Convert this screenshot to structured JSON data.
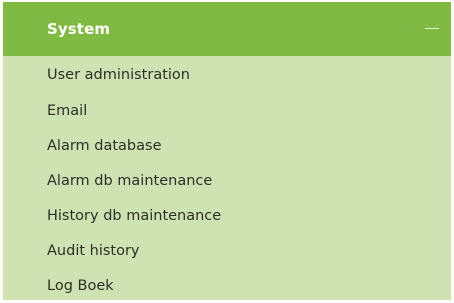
{
  "section": {
    "title": "System",
    "collapse_icon": "minus-icon"
  },
  "menu": {
    "items": [
      {
        "label": "User administration"
      },
      {
        "label": "Email"
      },
      {
        "label": "Alarm database"
      },
      {
        "label": "Alarm db maintenance"
      },
      {
        "label": "History db maintenance"
      },
      {
        "label": "Audit history"
      },
      {
        "label": "Log Boek"
      }
    ]
  },
  "colors": {
    "header_bg": "#7fbb42",
    "menu_bg": "#cfe3b2",
    "header_text": "#ffffff",
    "item_text": "#2b2f28"
  }
}
